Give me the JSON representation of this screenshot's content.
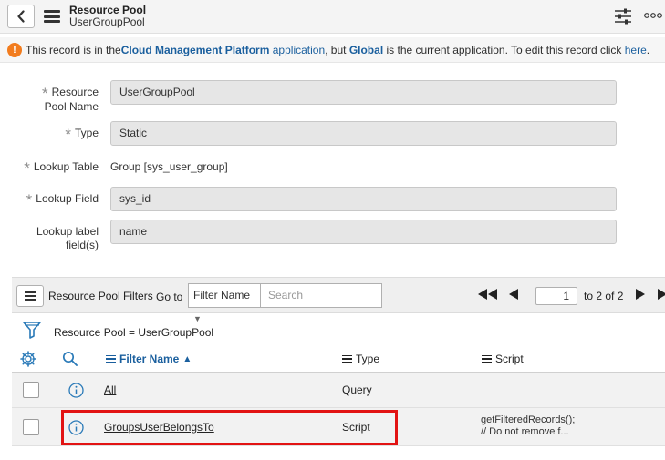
{
  "header": {
    "title": "Resource Pool",
    "subtitle": "UserGroupPool"
  },
  "notice": {
    "icon": "warning-icon",
    "text_1": "This record is in the ",
    "app_name": "Cloud Management Platform",
    "app_link": "application",
    "text_2": ", but ",
    "current_app": "Global",
    "text_3": " is the current application. To edit this record click ",
    "here_link": "here",
    "text_4": "."
  },
  "form": {
    "pool_name": {
      "label_1": "Resource",
      "label_2": "Pool Name",
      "value": "UserGroupPool",
      "required": true
    },
    "type": {
      "label": "Type",
      "value": "Static",
      "required": true
    },
    "lookup_table": {
      "label": "Lookup Table",
      "value": "Group [sys_user_group]",
      "required": true
    },
    "lookup_field": {
      "label": "Lookup Field",
      "value": "sys_id",
      "required": true
    },
    "lookup_label": {
      "label_1": "Lookup label",
      "label_2": "field(s)",
      "value": "name",
      "required": false
    }
  },
  "list": {
    "title": "Resource Pool Filters",
    "goto_label": "Go to",
    "filter_select": "Filter Name",
    "search_placeholder": "Search",
    "page_current": "1",
    "page_of": "to 2 of 2",
    "breadcrumb": "Resource Pool = UserGroupPool",
    "columns": {
      "name": "Filter Name",
      "type": "Type",
      "script": "Script"
    },
    "rows": [
      {
        "name": "All",
        "type": "Query",
        "script_1": "",
        "script_2": ""
      },
      {
        "name": "GroupsUserBelongsTo",
        "type": "Script",
        "script_1": "getFilteredRecords();",
        "script_2": "// Do not remove f..."
      }
    ]
  },
  "colors": {
    "link": "#1a5f9e",
    "warning": "#f27c1e",
    "highlight": "#e21313"
  }
}
